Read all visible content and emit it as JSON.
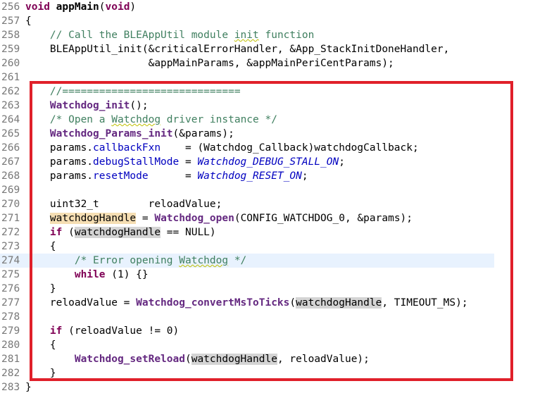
{
  "editor": {
    "lines": [
      {
        "num": "256",
        "tokens": [
          {
            "t": "void",
            "c": "kw"
          },
          {
            "t": " "
          },
          {
            "t": "appMain",
            "c": "b"
          },
          {
            "t": "("
          },
          {
            "t": "void",
            "c": "kw"
          },
          {
            "t": ")"
          }
        ]
      },
      {
        "num": "257",
        "tokens": [
          {
            "t": "{"
          }
        ]
      },
      {
        "num": "258",
        "tokens": [
          {
            "t": "    "
          },
          {
            "t": "// Call the BLEAppUtil module ",
            "c": "cm"
          },
          {
            "t": "init",
            "c": "cm sq"
          },
          {
            "t": " function",
            "c": "cm"
          }
        ]
      },
      {
        "num": "259",
        "tokens": [
          {
            "t": "    BLEAppUtil_init(&criticalErrorHandler, &App_StackInitDoneHandler,"
          }
        ]
      },
      {
        "num": "260",
        "tokens": [
          {
            "t": "                    &appMainParams, &appMainPeriCentParams);"
          }
        ]
      },
      {
        "num": "261",
        "tokens": []
      },
      {
        "num": "262",
        "tokens": [
          {
            "t": "    "
          },
          {
            "t": "//=============================",
            "c": "cm"
          }
        ]
      },
      {
        "num": "263",
        "tokens": [
          {
            "t": "    "
          },
          {
            "t": "Watchdog_init",
            "c": "fn"
          },
          {
            "t": "();"
          }
        ]
      },
      {
        "num": "264",
        "tokens": [
          {
            "t": "    "
          },
          {
            "t": "/* Open a ",
            "c": "cm"
          },
          {
            "t": "Watchdog",
            "c": "cm sq"
          },
          {
            "t": " driver instance */",
            "c": "cm"
          }
        ]
      },
      {
        "num": "265",
        "tokens": [
          {
            "t": "    "
          },
          {
            "t": "Watchdog_Params_init",
            "c": "fn"
          },
          {
            "t": "(&params);"
          }
        ]
      },
      {
        "num": "266",
        "tokens": [
          {
            "t": "    params."
          },
          {
            "t": "callbackFxn",
            "c": "fd"
          },
          {
            "t": "    = (Watchdog_Callback)watchdogCallback;"
          }
        ]
      },
      {
        "num": "267",
        "tokens": [
          {
            "t": "    params."
          },
          {
            "t": "debugStallMode",
            "c": "fd"
          },
          {
            "t": " = "
          },
          {
            "t": "Watchdog_DEBUG_STALL_ON",
            "c": "en"
          },
          {
            "t": ";"
          }
        ]
      },
      {
        "num": "268",
        "tokens": [
          {
            "t": "    params."
          },
          {
            "t": "resetMode",
            "c": "fd"
          },
          {
            "t": "      = "
          },
          {
            "t": "Watchdog_RESET_ON",
            "c": "en"
          },
          {
            "t": ";"
          }
        ]
      },
      {
        "num": "269",
        "tokens": []
      },
      {
        "num": "270",
        "tokens": [
          {
            "t": "    uint32_t        reloadValue;"
          }
        ]
      },
      {
        "num": "271",
        "tokens": [
          {
            "t": "    "
          },
          {
            "t": "watchdogHandle",
            "c": "hlw"
          },
          {
            "t": " = "
          },
          {
            "t": "Watchdog_open",
            "c": "fn"
          },
          {
            "t": "(CONFIG_WATCHDOG_0, &params);"
          }
        ]
      },
      {
        "num": "272",
        "tokens": [
          {
            "t": "    "
          },
          {
            "t": "if",
            "c": "kw"
          },
          {
            "t": " ("
          },
          {
            "t": "watchdogHandle",
            "c": "hl"
          },
          {
            "t": " == NULL)"
          }
        ]
      },
      {
        "num": "273",
        "tokens": [
          {
            "t": "    {"
          }
        ]
      },
      {
        "num": "274",
        "tokens": [
          {
            "t": "        "
          },
          {
            "t": "/* Error opening ",
            "c": "cm"
          },
          {
            "t": "Watchdog",
            "c": "cm sq"
          },
          {
            "t": " */",
            "c": "cm"
          }
        ],
        "current": true
      },
      {
        "num": "275",
        "tokens": [
          {
            "t": "        "
          },
          {
            "t": "while",
            "c": "kw"
          },
          {
            "t": " (1) {}"
          }
        ]
      },
      {
        "num": "276",
        "tokens": [
          {
            "t": "    }"
          }
        ]
      },
      {
        "num": "277",
        "tokens": [
          {
            "t": "    reloadValue = "
          },
          {
            "t": "Watchdog_convertMsToTicks",
            "c": "fn"
          },
          {
            "t": "("
          },
          {
            "t": "watchdogHandle",
            "c": "hl"
          },
          {
            "t": ", TIMEOUT_MS);"
          }
        ]
      },
      {
        "num": "278",
        "tokens": []
      },
      {
        "num": "279",
        "tokens": [
          {
            "t": "    "
          },
          {
            "t": "if",
            "c": "kw"
          },
          {
            "t": " (reloadValue != 0)"
          }
        ]
      },
      {
        "num": "280",
        "tokens": [
          {
            "t": "    {"
          }
        ]
      },
      {
        "num": "281",
        "tokens": [
          {
            "t": "        "
          },
          {
            "t": "Watchdog_setReload",
            "c": "fn"
          },
          {
            "t": "("
          },
          {
            "t": "watchdogHandle",
            "c": "hl"
          },
          {
            "t": ", reloadValue);"
          }
        ]
      },
      {
        "num": "282",
        "tokens": [
          {
            "t": "    }"
          }
        ]
      },
      {
        "num": "283",
        "tokens": [
          {
            "t": "}"
          }
        ]
      }
    ]
  },
  "colors": {
    "highlight_box": "#e0202a",
    "keyword": "#7f0055",
    "comment": "#3f7f5f",
    "function": "#642880",
    "enum": "#0000c0",
    "current_line": "#e8f2fe"
  }
}
